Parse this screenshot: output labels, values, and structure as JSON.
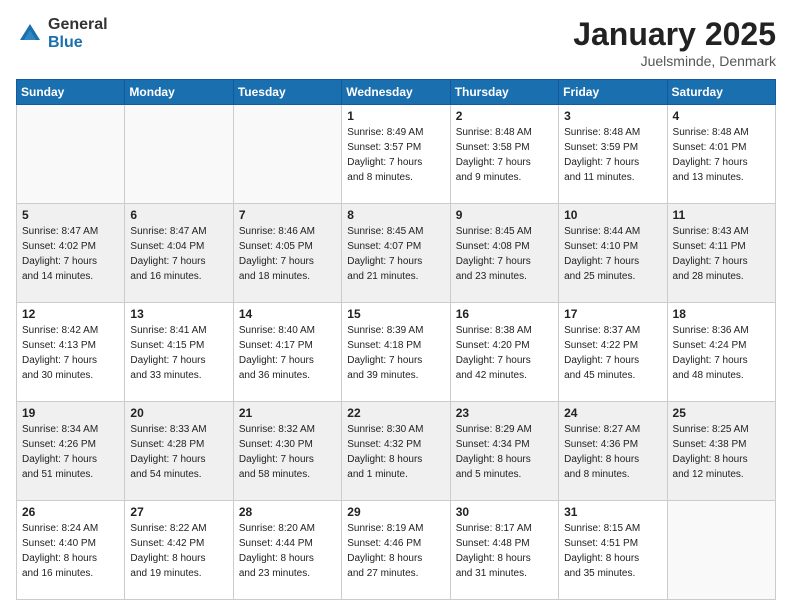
{
  "logo": {
    "general": "General",
    "blue": "Blue"
  },
  "header": {
    "title": "January 2025",
    "location": "Juelsminde, Denmark"
  },
  "weekdays": [
    "Sunday",
    "Monday",
    "Tuesday",
    "Wednesday",
    "Thursday",
    "Friday",
    "Saturday"
  ],
  "weeks": [
    [
      {
        "day": "",
        "info": ""
      },
      {
        "day": "",
        "info": ""
      },
      {
        "day": "",
        "info": ""
      },
      {
        "day": "1",
        "info": "Sunrise: 8:49 AM\nSunset: 3:57 PM\nDaylight: 7 hours\nand 8 minutes."
      },
      {
        "day": "2",
        "info": "Sunrise: 8:48 AM\nSunset: 3:58 PM\nDaylight: 7 hours\nand 9 minutes."
      },
      {
        "day": "3",
        "info": "Sunrise: 8:48 AM\nSunset: 3:59 PM\nDaylight: 7 hours\nand 11 minutes."
      },
      {
        "day": "4",
        "info": "Sunrise: 8:48 AM\nSunset: 4:01 PM\nDaylight: 7 hours\nand 13 minutes."
      }
    ],
    [
      {
        "day": "5",
        "info": "Sunrise: 8:47 AM\nSunset: 4:02 PM\nDaylight: 7 hours\nand 14 minutes."
      },
      {
        "day": "6",
        "info": "Sunrise: 8:47 AM\nSunset: 4:04 PM\nDaylight: 7 hours\nand 16 minutes."
      },
      {
        "day": "7",
        "info": "Sunrise: 8:46 AM\nSunset: 4:05 PM\nDaylight: 7 hours\nand 18 minutes."
      },
      {
        "day": "8",
        "info": "Sunrise: 8:45 AM\nSunset: 4:07 PM\nDaylight: 7 hours\nand 21 minutes."
      },
      {
        "day": "9",
        "info": "Sunrise: 8:45 AM\nSunset: 4:08 PM\nDaylight: 7 hours\nand 23 minutes."
      },
      {
        "day": "10",
        "info": "Sunrise: 8:44 AM\nSunset: 4:10 PM\nDaylight: 7 hours\nand 25 minutes."
      },
      {
        "day": "11",
        "info": "Sunrise: 8:43 AM\nSunset: 4:11 PM\nDaylight: 7 hours\nand 28 minutes."
      }
    ],
    [
      {
        "day": "12",
        "info": "Sunrise: 8:42 AM\nSunset: 4:13 PM\nDaylight: 7 hours\nand 30 minutes."
      },
      {
        "day": "13",
        "info": "Sunrise: 8:41 AM\nSunset: 4:15 PM\nDaylight: 7 hours\nand 33 minutes."
      },
      {
        "day": "14",
        "info": "Sunrise: 8:40 AM\nSunset: 4:17 PM\nDaylight: 7 hours\nand 36 minutes."
      },
      {
        "day": "15",
        "info": "Sunrise: 8:39 AM\nSunset: 4:18 PM\nDaylight: 7 hours\nand 39 minutes."
      },
      {
        "day": "16",
        "info": "Sunrise: 8:38 AM\nSunset: 4:20 PM\nDaylight: 7 hours\nand 42 minutes."
      },
      {
        "day": "17",
        "info": "Sunrise: 8:37 AM\nSunset: 4:22 PM\nDaylight: 7 hours\nand 45 minutes."
      },
      {
        "day": "18",
        "info": "Sunrise: 8:36 AM\nSunset: 4:24 PM\nDaylight: 7 hours\nand 48 minutes."
      }
    ],
    [
      {
        "day": "19",
        "info": "Sunrise: 8:34 AM\nSunset: 4:26 PM\nDaylight: 7 hours\nand 51 minutes."
      },
      {
        "day": "20",
        "info": "Sunrise: 8:33 AM\nSunset: 4:28 PM\nDaylight: 7 hours\nand 54 minutes."
      },
      {
        "day": "21",
        "info": "Sunrise: 8:32 AM\nSunset: 4:30 PM\nDaylight: 7 hours\nand 58 minutes."
      },
      {
        "day": "22",
        "info": "Sunrise: 8:30 AM\nSunset: 4:32 PM\nDaylight: 8 hours\nand 1 minute."
      },
      {
        "day": "23",
        "info": "Sunrise: 8:29 AM\nSunset: 4:34 PM\nDaylight: 8 hours\nand 5 minutes."
      },
      {
        "day": "24",
        "info": "Sunrise: 8:27 AM\nSunset: 4:36 PM\nDaylight: 8 hours\nand 8 minutes."
      },
      {
        "day": "25",
        "info": "Sunrise: 8:25 AM\nSunset: 4:38 PM\nDaylight: 8 hours\nand 12 minutes."
      }
    ],
    [
      {
        "day": "26",
        "info": "Sunrise: 8:24 AM\nSunset: 4:40 PM\nDaylight: 8 hours\nand 16 minutes."
      },
      {
        "day": "27",
        "info": "Sunrise: 8:22 AM\nSunset: 4:42 PM\nDaylight: 8 hours\nand 19 minutes."
      },
      {
        "day": "28",
        "info": "Sunrise: 8:20 AM\nSunset: 4:44 PM\nDaylight: 8 hours\nand 23 minutes."
      },
      {
        "day": "29",
        "info": "Sunrise: 8:19 AM\nSunset: 4:46 PM\nDaylight: 8 hours\nand 27 minutes."
      },
      {
        "day": "30",
        "info": "Sunrise: 8:17 AM\nSunset: 4:48 PM\nDaylight: 8 hours\nand 31 minutes."
      },
      {
        "day": "31",
        "info": "Sunrise: 8:15 AM\nSunset: 4:51 PM\nDaylight: 8 hours\nand 35 minutes."
      },
      {
        "day": "",
        "info": ""
      }
    ]
  ]
}
